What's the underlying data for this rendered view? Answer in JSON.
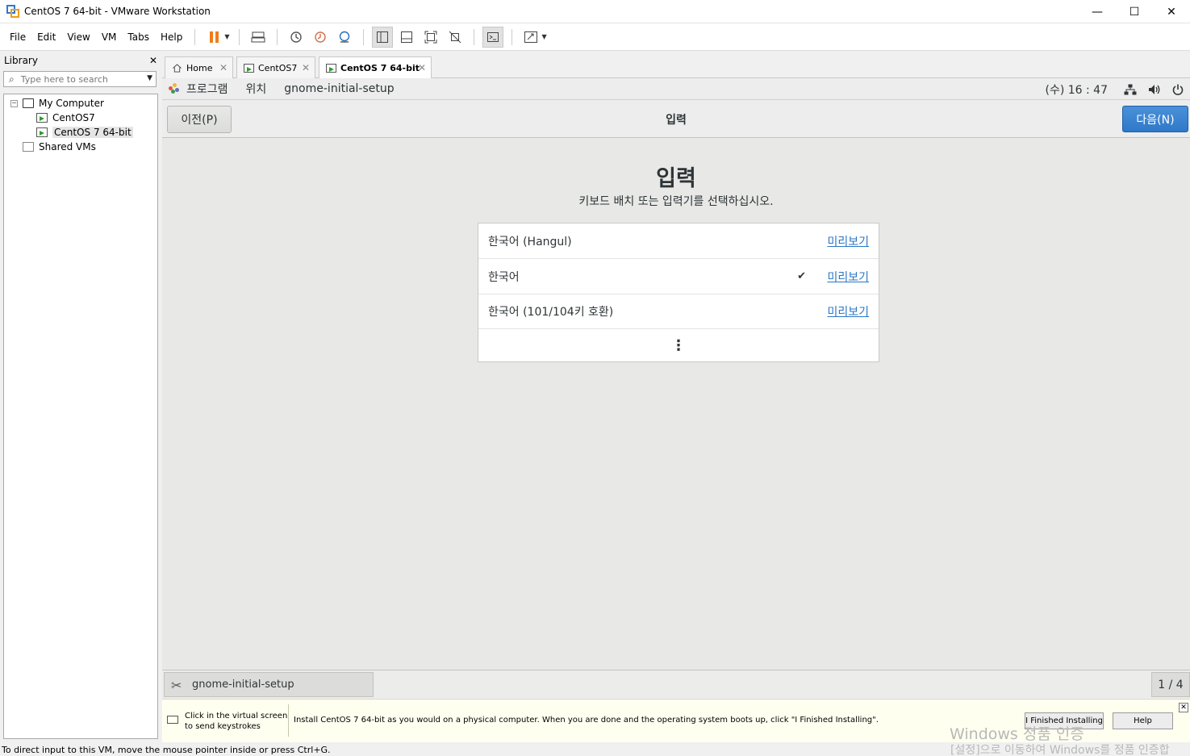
{
  "window": {
    "title": "CentOS 7 64-bit - VMware Workstation",
    "minimize": "—",
    "maximize": "☐",
    "close": "✕"
  },
  "menu": [
    "File",
    "Edit",
    "View",
    "VM",
    "Tabs",
    "Help"
  ],
  "library": {
    "title": "Library",
    "close": "✕",
    "search_placeholder": "Type here to search",
    "tree": {
      "root": "My Computer",
      "vm1": "CentOS7",
      "vm2": "CentOS 7 64-bit",
      "shared": "Shared VMs"
    }
  },
  "tabs": [
    {
      "label": "Home"
    },
    {
      "label": "CentOS7"
    },
    {
      "label": "CentOS 7 64-bit",
      "active": true
    }
  ],
  "gnome": {
    "topbar": {
      "apps": "프로그램",
      "places": "위치",
      "app_name": "gnome-initial-setup",
      "clock": "(수) 16 : 47"
    },
    "header": {
      "prev": "이전(P)",
      "title": "입력",
      "next": "다음(N)"
    },
    "heading": "입력",
    "subheading": "키보드 배치 또는 입력기를 선택하십시오.",
    "layouts": [
      {
        "name": "한국어 (Hangul)",
        "selected": false,
        "preview": "미리보기"
      },
      {
        "name": "한국어",
        "selected": true,
        "preview": "미리보기"
      },
      {
        "name": "한국어 (101/104키 호환)",
        "selected": false,
        "preview": "미리보기"
      }
    ],
    "more": "⋮",
    "taskbar": {
      "task": "gnome-initial-setup",
      "workspace": "1 / 4"
    }
  },
  "hintbar": {
    "left": "Click in the virtual screen to send keystrokes",
    "main": "Install CentOS 7 64-bit as you would on a physical computer. When you are done and the operating system boots up, click \"I Finished Installing\".",
    "finished_btn": "I Finished Installing",
    "help_btn": "Help",
    "watermark": "Windows 정품 인증",
    "watermark2": "[설정]으로 이동하여 Windows를 정품 인증합"
  },
  "statusbar": "To direct input to this VM, move the mouse pointer inside or press Ctrl+G.",
  "colors": {
    "accent": "#3079c9",
    "link": "#2a76c6",
    "pause": "#f07d1a"
  }
}
